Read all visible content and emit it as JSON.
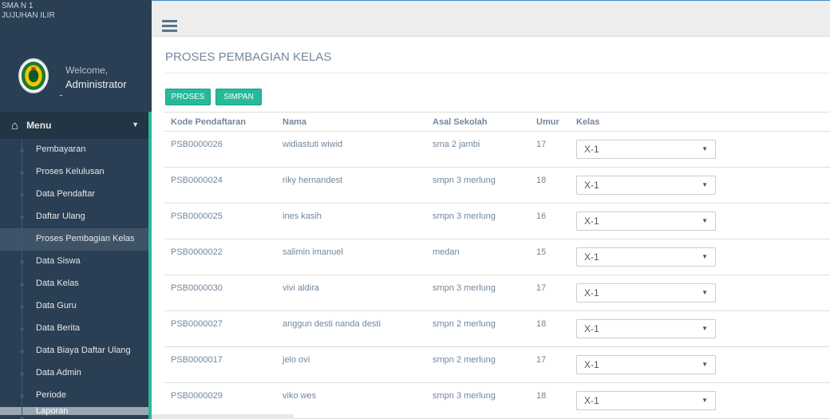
{
  "brand": {
    "line1": "SMA N 1",
    "line2": "JUJUHAN ILIR"
  },
  "profile": {
    "welcome": "Welcome,",
    "name": "Administrator",
    "avatar_icon": "school-logo-icon"
  },
  "menu": {
    "head": "Menu",
    "home_icon": "home-icon",
    "items": [
      {
        "label": "Pembayaran"
      },
      {
        "label": "Proses Kelulusan"
      },
      {
        "label": "Data Pendaftar"
      },
      {
        "label": "Daftar Ulang"
      },
      {
        "label": "Proses Pembagian Kelas"
      },
      {
        "label": "Data Siswa"
      },
      {
        "label": "Data Kelas"
      },
      {
        "label": "Data Guru"
      },
      {
        "label": "Data Berita"
      },
      {
        "label": "Data Biaya Daftar Ulang"
      },
      {
        "label": "Data Admin"
      },
      {
        "label": "Periode"
      },
      {
        "label": "Laporan"
      }
    ],
    "active_index": 4
  },
  "page": {
    "title": "PROSES PEMBAGIAN KELAS",
    "btn_proses": "PROSES",
    "btn_simpan": "SIMPAN"
  },
  "table": {
    "headers": [
      "Kode Pendaftaran",
      "Nama",
      "Asal Sekolah",
      "Umur",
      "Kelas"
    ],
    "rows": [
      {
        "kode": "PSB0000026",
        "nama": "widiastuti wiwid",
        "asal": "sma 2 jambi",
        "umur": "17",
        "kelas": "X-1"
      },
      {
        "kode": "PSB0000024",
        "nama": "riky hernandest",
        "asal": "smpn 3 merlung",
        "umur": "18",
        "kelas": "X-1"
      },
      {
        "kode": "PSB0000025",
        "nama": "ines kasih",
        "asal": "smpn 3 merlung",
        "umur": "16",
        "kelas": "X-1"
      },
      {
        "kode": "PSB0000022",
        "nama": "salimin imanuel",
        "asal": "medan",
        "umur": "15",
        "kelas": "X-1"
      },
      {
        "kode": "PSB0000030",
        "nama": "vivi aldira",
        "asal": "smpn 3 merlung",
        "umur": "17",
        "kelas": "X-1"
      },
      {
        "kode": "PSB0000027",
        "nama": "anggun desti nanda desti",
        "asal": "smpn 2 merlung",
        "umur": "18",
        "kelas": "X-1"
      },
      {
        "kode": "PSB0000017",
        "nama": "jelo ovi",
        "asal": "smpn 2 merlung",
        "umur": "17",
        "kelas": "X-1"
      },
      {
        "kode": "PSB0000029",
        "nama": "viko wes",
        "asal": "smpn 3 merlung",
        "umur": "18",
        "kelas": "X-1"
      }
    ]
  },
  "colors": {
    "sidebar": "#2a3f54",
    "accent": "#26b99a",
    "text": "#73879c"
  }
}
